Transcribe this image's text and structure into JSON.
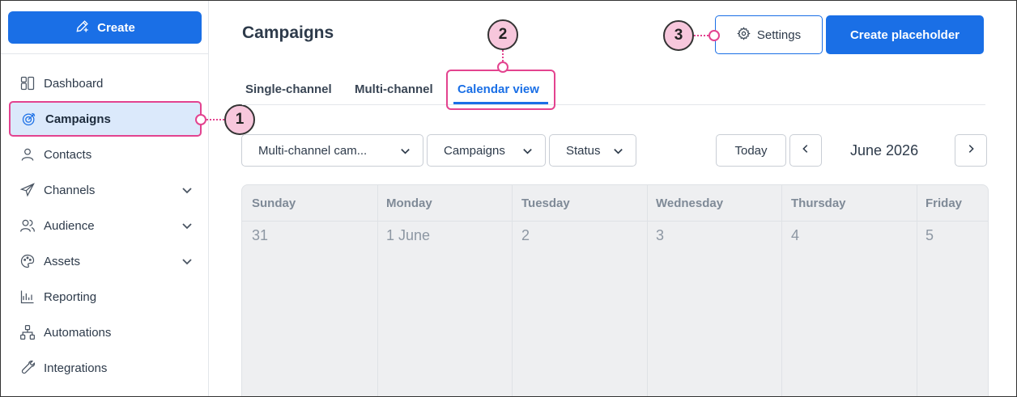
{
  "sidebar": {
    "create_label": "Create",
    "items": [
      {
        "label": "Dashboard",
        "icon": "dashboard-icon"
      },
      {
        "label": "Campaigns",
        "icon": "campaigns-icon",
        "active": true
      },
      {
        "label": "Contacts",
        "icon": "contacts-icon"
      },
      {
        "label": "Channels",
        "icon": "channels-icon",
        "expandable": true
      },
      {
        "label": "Audience",
        "icon": "audience-icon",
        "expandable": true
      },
      {
        "label": "Assets",
        "icon": "assets-icon",
        "expandable": true
      },
      {
        "label": "Reporting",
        "icon": "reporting-icon"
      },
      {
        "label": "Automations",
        "icon": "automations-icon"
      },
      {
        "label": "Integrations",
        "icon": "integrations-icon"
      }
    ]
  },
  "header": {
    "title": "Campaigns",
    "settings_label": "Settings",
    "create_placeholder_label": "Create placeholder"
  },
  "tabs": [
    {
      "label": "Single-channel"
    },
    {
      "label": "Multi-channel"
    },
    {
      "label": "Calendar view",
      "active": true
    }
  ],
  "filters": {
    "type": "Multi-channel cam...",
    "campaigns": "Campaigns",
    "status": "Status"
  },
  "calendar_nav": {
    "today_label": "Today",
    "month": "June 2026"
  },
  "calendar": {
    "days": [
      "Sunday",
      "Monday",
      "Tuesday",
      "Wednesday",
      "Thursday",
      "Friday"
    ],
    "dates": [
      "31",
      "1 June",
      "2",
      "3",
      "4",
      "5"
    ]
  },
  "callouts": [
    "1",
    "2",
    "3"
  ],
  "colors": {
    "primary": "#1a6fe6",
    "highlight": "#e3438f",
    "callout_fill": "#f7c7dc",
    "active_bg": "#dbe9fb"
  }
}
